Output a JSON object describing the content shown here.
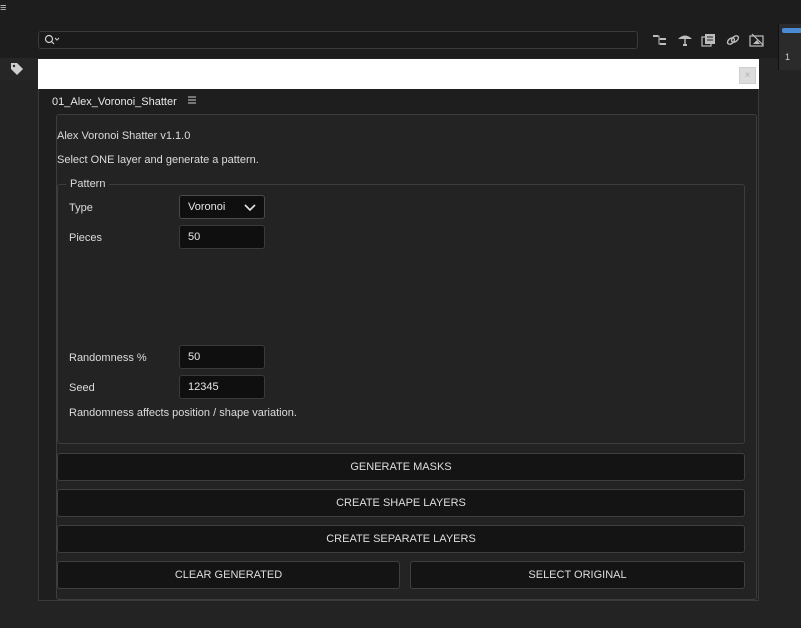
{
  "app": {
    "menu_glyph": "≡",
    "right_panel_mark": "1"
  },
  "search": {
    "placeholder": "",
    "value": ""
  },
  "toolbar_icons": [
    "hierarchy-icon",
    "parachute-icon",
    "layers-icon",
    "link-icon",
    "crop-icon"
  ],
  "panel": {
    "title": "01_Alex_Voronoi_Shatter",
    "close_glyph": "×"
  },
  "script": {
    "name_version": "Alex Voronoi Shatter  v1.1.0",
    "instruction": "Select ONE layer and generate a pattern.",
    "group_label": "Pattern",
    "type_label": "Type",
    "type_value": "Voronoi",
    "pieces_label": "Pieces",
    "pieces_value": "50",
    "randomness_label": "Randomness %",
    "randomness_value": "50",
    "seed_label": "Seed",
    "seed_value": "12345",
    "hint": "Randomness affects position / shape variation."
  },
  "buttons": {
    "generate_masks": "GENERATE MASKS",
    "create_shape_layers": "CREATE SHAPE LAYERS",
    "create_separate_layers": "CREATE SEPARATE LAYERS",
    "clear_generated": "CLEAR GENERATED",
    "select_original": "SELECT ORIGINAL"
  },
  "colors": {
    "background": "#232323",
    "field": "#0f0f0f",
    "accent": "#4a8bd4"
  }
}
